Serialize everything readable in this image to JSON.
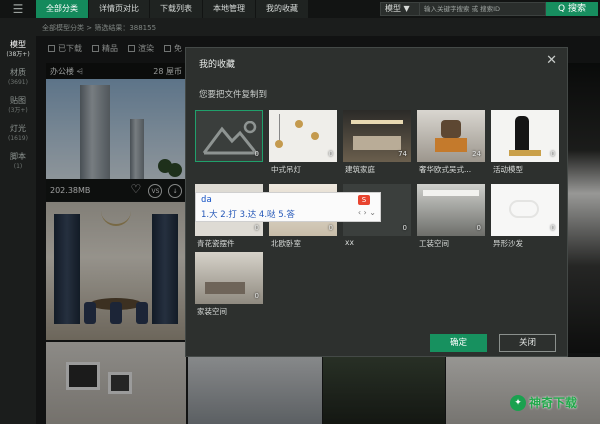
{
  "nav": {
    "menu_icon": "hamburger-icon",
    "items": [
      {
        "label": "全部分类",
        "active": true
      },
      {
        "label": "详情页对比",
        "active": false
      },
      {
        "label": "下载列表",
        "active": false
      },
      {
        "label": "本地管理",
        "active": false
      },
      {
        "label": "我的收藏",
        "active": false
      }
    ]
  },
  "search": {
    "category": "模型 ▼",
    "placeholder": "输入关键字搜索 或 搜索ID",
    "button": "Q 搜索"
  },
  "breadcrumb": "全部模型分类  >  筛选结果：388155",
  "sidebar": [
    {
      "label": "模型",
      "count": "(38万+)",
      "active": true
    },
    {
      "label": "材质",
      "count": "(3691)",
      "active": false
    },
    {
      "label": "贴图",
      "count": "(3万+)",
      "active": false
    },
    {
      "label": "灯光",
      "count": "(1619)",
      "active": false
    },
    {
      "label": "脚本",
      "count": "(1)",
      "active": false
    }
  ],
  "filters": [
    "已下载",
    "精品",
    "渲染",
    "免"
  ],
  "card": {
    "name": "办公楼",
    "price": "28 屋币",
    "size": "202.38MB",
    "vs": "VS"
  },
  "dialog": {
    "title": "我的收藏",
    "close": "✕",
    "subtitle": "您要把文件复制到",
    "tiles": [
      {
        "label": "",
        "count": "0",
        "selected": true
      },
      {
        "label": "中式吊灯",
        "count": "0"
      },
      {
        "label": "建筑家庭",
        "count": "74"
      },
      {
        "label": "奢华欧式吴式...",
        "count": "24"
      },
      {
        "label": "活动模型",
        "count": "0"
      },
      {
        "label": "青花瓷摆件",
        "count": "0"
      },
      {
        "label": "北欧卧室",
        "count": "0"
      },
      {
        "label": "xx",
        "count": "0"
      },
      {
        "label": "工装空间",
        "count": "0"
      },
      {
        "label": "异形沙发",
        "count": "0"
      },
      {
        "label": "家装空间",
        "count": "0"
      }
    ],
    "ok": "确定",
    "cancel": "关闭"
  },
  "ime": {
    "input": "da",
    "candidates": "1.大  2.打  3.达  4.哒  5.答",
    "nav": "‹  ›  ⌄",
    "logo": "S"
  },
  "watermark": {
    "text": "神奇下载"
  },
  "colors": {
    "accent": "#17915f",
    "dialog_bg": "#2d302e",
    "top_bg": "#121413"
  }
}
